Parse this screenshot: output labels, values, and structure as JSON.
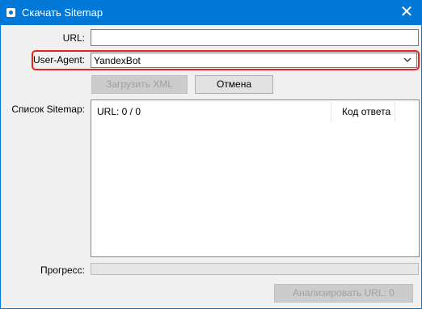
{
  "window": {
    "title": "Скачать Sitemap",
    "close_label": "✕"
  },
  "form": {
    "url_label": "URL:",
    "url_value": "",
    "user_agent_label": "User-Agent:",
    "user_agent_value": "YandexBot",
    "load_xml_label": "Загрузить XML",
    "cancel_label": "Отмена",
    "sitemap_list_label": "Список Sitemap:",
    "progress_label": "Прогресс:",
    "progress_value": 0,
    "analyze_label": "Анализировать URL: 0"
  },
  "sitemap_list": {
    "columns": [
      "URL: 0 / 0",
      "Код ответа"
    ],
    "rows": []
  },
  "colors": {
    "titlebar": "#0078d7",
    "highlight": "#e8231d",
    "window_bg": "#f0f0f0"
  },
  "icons": {
    "app": "app-icon",
    "close": "close-icon",
    "dropdown": "chevron-down-icon"
  }
}
